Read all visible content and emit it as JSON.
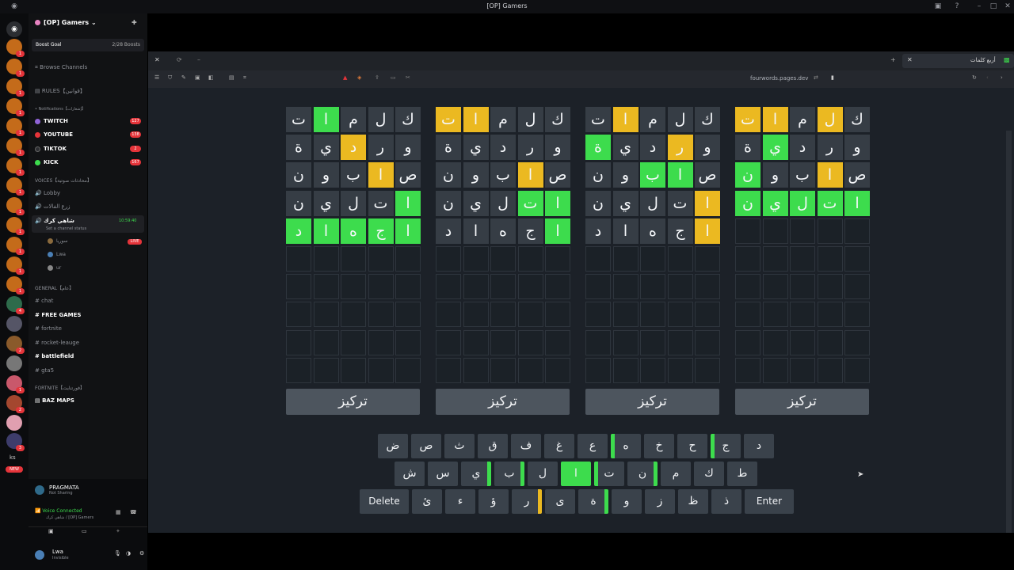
{
  "window": {
    "title": "[OP] Gamers"
  },
  "server": {
    "name": "[OP] Gamers",
    "boost_goal": "Boost Goal",
    "boost_count": "2/28 Boosts",
    "browse": "Browse Channels",
    "rules": "RULES【قوانين】",
    "notifications": "Notifications【إشعارات】",
    "channels": [
      {
        "name": "TWITCH",
        "badge": "127",
        "color": "#8f63d6"
      },
      {
        "name": "YOUTUBE",
        "badge": "138",
        "color": "#e5343a"
      },
      {
        "name": "TIKTOK",
        "badge": "2",
        "color": "#2b2c30"
      },
      {
        "name": "KICK",
        "badge": "167",
        "color": "#3ddc4d"
      }
    ],
    "voices_cat": "VOICES【محادثات صوتية】",
    "lobby": "Lobby",
    "voice2": "زرع الفالات",
    "active_voice": "شاهي كرك",
    "active_time": "10:59:40",
    "active_status": "Set a channel status",
    "live": "LIVE",
    "members": [
      "سوريا",
      "Lwa",
      "ur"
    ],
    "general_cat": "GENERAL【عام】",
    "chat": "chat",
    "free_games": "FREE GAMES",
    "fortnite": "fortnite",
    "rocket": "rocket-leauge",
    "battlefield": "battlefield",
    "gta": "gta5",
    "fortnite_cat": "FORTNITE【فورتنايت】",
    "baz_maps": "BAZ MAPS"
  },
  "user_panel": {
    "activity": "PRAGMATA",
    "activity_sub": "Not Sharing",
    "voice": "Voice Connected",
    "voice_sub": "شاهي كرك / [OP] Gamers",
    "username": "Lwa",
    "user_status": "Invisible"
  },
  "rail": {
    "ks": "ks",
    "new": "NEW"
  },
  "browser": {
    "tab_title": "أربع كلمات",
    "url": "fourwords.pages.dev"
  },
  "game": {
    "focus_label": "تركيز",
    "boards": [
      {
        "rows": [
          [
            [
              "ت",
              "n"
            ],
            [
              "ا",
              "g"
            ],
            [
              "م",
              "n"
            ],
            [
              "ل",
              "n"
            ],
            [
              "ك",
              "n"
            ]
          ],
          [
            [
              "ة",
              "n"
            ],
            [
              "ي",
              "n"
            ],
            [
              "د",
              "y"
            ],
            [
              "ر",
              "n"
            ],
            [
              "و",
              "n"
            ]
          ],
          [
            [
              "ن",
              "n"
            ],
            [
              "و",
              "n"
            ],
            [
              "ب",
              "n"
            ],
            [
              "ا",
              "y"
            ],
            [
              "ص",
              "n"
            ]
          ],
          [
            [
              "ن",
              "n"
            ],
            [
              "ي",
              "n"
            ],
            [
              "ل",
              "n"
            ],
            [
              "ت",
              "n"
            ],
            [
              "ا",
              "g"
            ]
          ],
          [
            [
              "د",
              "g"
            ],
            [
              "ا",
              "g"
            ],
            [
              "ه",
              "g"
            ],
            [
              "ج",
              "g"
            ],
            [
              "ا",
              "g"
            ]
          ]
        ]
      },
      {
        "rows": [
          [
            [
              "ت",
              "y"
            ],
            [
              "ا",
              "y"
            ],
            [
              "م",
              "n"
            ],
            [
              "ل",
              "n"
            ],
            [
              "ك",
              "n"
            ]
          ],
          [
            [
              "ة",
              "n"
            ],
            [
              "ي",
              "n"
            ],
            [
              "د",
              "n"
            ],
            [
              "ر",
              "n"
            ],
            [
              "و",
              "n"
            ]
          ],
          [
            [
              "ن",
              "n"
            ],
            [
              "و",
              "n"
            ],
            [
              "ب",
              "n"
            ],
            [
              "ا",
              "y"
            ],
            [
              "ص",
              "n"
            ]
          ],
          [
            [
              "ن",
              "n"
            ],
            [
              "ي",
              "n"
            ],
            [
              "ل",
              "n"
            ],
            [
              "ت",
              "g"
            ],
            [
              "ا",
              "g"
            ]
          ],
          [
            [
              "د",
              "n"
            ],
            [
              "ا",
              "n"
            ],
            [
              "ه",
              "n"
            ],
            [
              "ج",
              "n"
            ],
            [
              "ا",
              "g"
            ]
          ]
        ]
      },
      {
        "rows": [
          [
            [
              "ت",
              "n"
            ],
            [
              "ا",
              "y"
            ],
            [
              "م",
              "n"
            ],
            [
              "ل",
              "n"
            ],
            [
              "ك",
              "n"
            ]
          ],
          [
            [
              "ة",
              "g"
            ],
            [
              "ي",
              "n"
            ],
            [
              "د",
              "n"
            ],
            [
              "ر",
              "y"
            ],
            [
              "و",
              "n"
            ]
          ],
          [
            [
              "ن",
              "n"
            ],
            [
              "و",
              "n"
            ],
            [
              "ب",
              "g"
            ],
            [
              "ا",
              "g"
            ],
            [
              "ص",
              "n"
            ]
          ],
          [
            [
              "ن",
              "n"
            ],
            [
              "ي",
              "n"
            ],
            [
              "ل",
              "n"
            ],
            [
              "ت",
              "n"
            ],
            [
              "ا",
              "y"
            ]
          ],
          [
            [
              "د",
              "n"
            ],
            [
              "ا",
              "n"
            ],
            [
              "ه",
              "n"
            ],
            [
              "ج",
              "n"
            ],
            [
              "ا",
              "y"
            ]
          ]
        ]
      },
      {
        "rows": [
          [
            [
              "ت",
              "y"
            ],
            [
              "ا",
              "y"
            ],
            [
              "م",
              "n"
            ],
            [
              "ل",
              "y"
            ],
            [
              "ك",
              "n"
            ]
          ],
          [
            [
              "ة",
              "n"
            ],
            [
              "ي",
              "g"
            ],
            [
              "د",
              "n"
            ],
            [
              "ر",
              "n"
            ],
            [
              "و",
              "n"
            ]
          ],
          [
            [
              "ن",
              "g"
            ],
            [
              "و",
              "n"
            ],
            [
              "ب",
              "n"
            ],
            [
              "ا",
              "y"
            ],
            [
              "ص",
              "n"
            ]
          ],
          [
            [
              "ن",
              "g"
            ],
            [
              "ي",
              "g"
            ],
            [
              "ل",
              "g"
            ],
            [
              "ت",
              "g"
            ],
            [
              "ا",
              "g"
            ]
          ]
        ]
      }
    ],
    "keyboard": {
      "row1": [
        "ض",
        "ص",
        "ث",
        "ق",
        "ف",
        "غ",
        "ع",
        "ه",
        "خ",
        "ح",
        "ج",
        "د"
      ],
      "row2": [
        "ش",
        "س",
        "ي",
        "ب",
        "ل",
        "ا",
        "ت",
        "ن",
        "م",
        "ك",
        "ط"
      ],
      "row3": [
        "Delete",
        "ئ",
        "ء",
        "ؤ",
        "ر",
        "ى",
        "ة",
        "و",
        "ز",
        "ظ",
        "ذ",
        "Enter"
      ]
    }
  }
}
